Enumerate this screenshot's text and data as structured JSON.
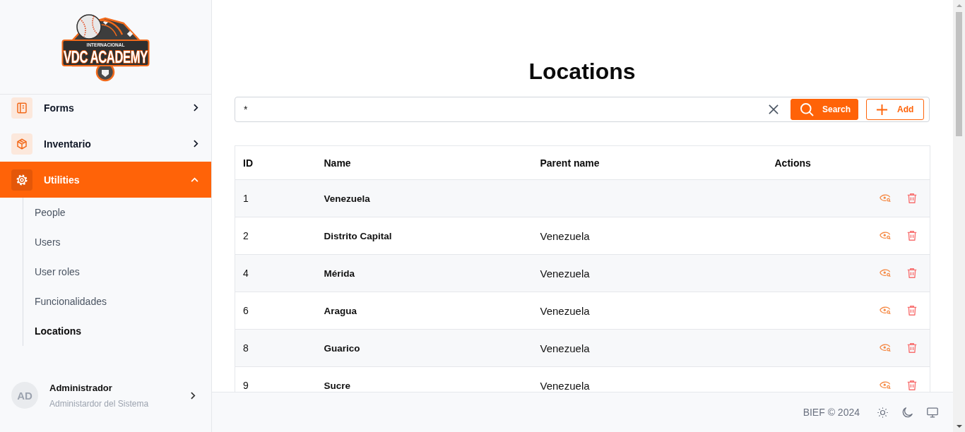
{
  "sidebar": {
    "logo": {
      "subtitle": "INTERNACIONAL",
      "title": "VDC ACADEMY"
    },
    "items": [
      {
        "label": "Forms",
        "selected": false,
        "expanded": false
      },
      {
        "label": "Inventario",
        "selected": false,
        "expanded": false
      },
      {
        "label": "Utilities",
        "selected": true,
        "expanded": true,
        "children": [
          {
            "label": "People",
            "selected": false
          },
          {
            "label": "Users",
            "selected": false
          },
          {
            "label": "User roles",
            "selected": false
          },
          {
            "label": "Funcionalidades",
            "selected": false
          },
          {
            "label": "Locations",
            "selected": true
          }
        ]
      }
    ],
    "user": {
      "initials": "AD",
      "name": "Administrador",
      "role": "Administardor del Sistema"
    }
  },
  "main": {
    "title": "Locations",
    "search": {
      "value": "*"
    },
    "buttons": [
      {
        "label": "Search",
        "kind": "primary"
      },
      {
        "label": "Add",
        "kind": "outline"
      }
    ],
    "table": {
      "columns": [
        "ID",
        "Name",
        "Parent name",
        "Actions"
      ],
      "rows": [
        {
          "id": "1",
          "name": "Venezuela"
        },
        {
          "id": "2",
          "name": "Distrito Capital",
          "parent_name": "Venezuela"
        },
        {
          "id": "4",
          "name": "Mérida",
          "parent_name": "Venezuela"
        },
        {
          "id": "6",
          "name": "Aragua",
          "parent_name": "Venezuela"
        },
        {
          "id": "8",
          "name": "Guarico",
          "parent_name": "Venezuela"
        },
        {
          "id": "9",
          "name": "Sucre",
          "parent_name": "Venezuela"
        }
      ]
    }
  },
  "footer": {
    "text": "BIEF © 2024"
  }
}
